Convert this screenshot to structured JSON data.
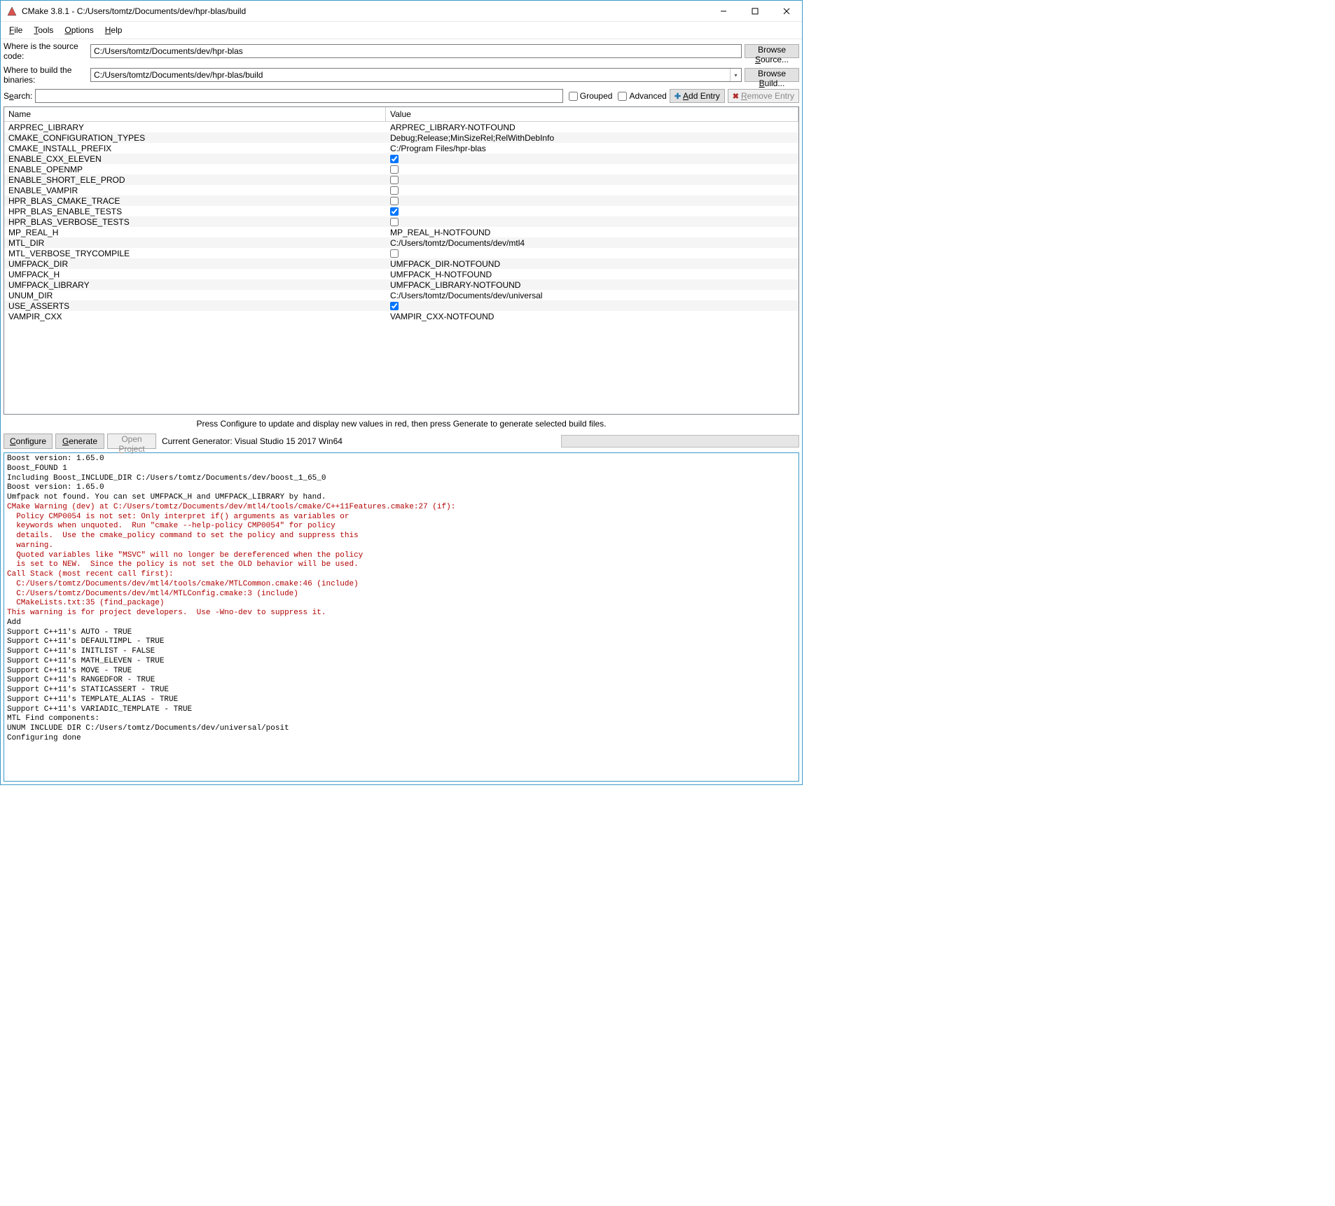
{
  "title": "CMake 3.8.1 - C:/Users/tomtz/Documents/dev/hpr-blas/build",
  "menu": {
    "file": "File",
    "tools": "Tools",
    "options": "Options",
    "help": "Help"
  },
  "paths": {
    "source_label": "Where is the source code:",
    "source_value": "C:/Users/tomtz/Documents/dev/hpr-blas",
    "browse_source": "Browse Source...",
    "build_label": "Where to build the binaries:",
    "build_value": "C:/Users/tomtz/Documents/dev/hpr-blas/build",
    "browse_build": "Browse Build..."
  },
  "search": {
    "label": "Search:",
    "value": "",
    "grouped_label": "Grouped",
    "grouped": false,
    "advanced_label": "Advanced",
    "advanced": false,
    "add_entry": "Add Entry",
    "remove_entry": "Remove Entry"
  },
  "table": {
    "header_name": "Name",
    "header_value": "Value",
    "rows": [
      {
        "name": "ARPREC_LIBRARY",
        "type": "text",
        "value": "ARPREC_LIBRARY-NOTFOUND"
      },
      {
        "name": "CMAKE_CONFIGURATION_TYPES",
        "type": "text",
        "value": "Debug;Release;MinSizeRel;RelWithDebInfo"
      },
      {
        "name": "CMAKE_INSTALL_PREFIX",
        "type": "text",
        "value": "C:/Program Files/hpr-blas"
      },
      {
        "name": "ENABLE_CXX_ELEVEN",
        "type": "bool",
        "checked": true
      },
      {
        "name": "ENABLE_OPENMP",
        "type": "bool",
        "checked": false
      },
      {
        "name": "ENABLE_SHORT_ELE_PROD",
        "type": "bool",
        "checked": false
      },
      {
        "name": "ENABLE_VAMPIR",
        "type": "bool",
        "checked": false
      },
      {
        "name": "HPR_BLAS_CMAKE_TRACE",
        "type": "bool",
        "checked": false
      },
      {
        "name": "HPR_BLAS_ENABLE_TESTS",
        "type": "bool",
        "checked": true
      },
      {
        "name": "HPR_BLAS_VERBOSE_TESTS",
        "type": "bool",
        "checked": false
      },
      {
        "name": "MP_REAL_H",
        "type": "text",
        "value": "MP_REAL_H-NOTFOUND"
      },
      {
        "name": "MTL_DIR",
        "type": "text",
        "value": "C:/Users/tomtz/Documents/dev/mtl4"
      },
      {
        "name": "MTL_VERBOSE_TRYCOMPILE",
        "type": "bool",
        "checked": false
      },
      {
        "name": "UMFPACK_DIR",
        "type": "text",
        "value": "UMFPACK_DIR-NOTFOUND"
      },
      {
        "name": "UMFPACK_H",
        "type": "text",
        "value": "UMFPACK_H-NOTFOUND"
      },
      {
        "name": "UMFPACK_LIBRARY",
        "type": "text",
        "value": "UMFPACK_LIBRARY-NOTFOUND"
      },
      {
        "name": "UNUM_DIR",
        "type": "text",
        "value": "C:/Users/tomtz/Documents/dev/universal"
      },
      {
        "name": "USE_ASSERTS",
        "type": "bool",
        "checked": true
      },
      {
        "name": "VAMPIR_CXX",
        "type": "text",
        "value": "VAMPIR_CXX-NOTFOUND"
      }
    ]
  },
  "hint": "Press Configure to update and display new values in red, then press Generate to generate selected build files.",
  "actions": {
    "configure": "Configure",
    "generate": "Generate",
    "open_project": "Open Project",
    "generator_label": "Current Generator: Visual Studio 15 2017 Win64"
  },
  "output_lines": [
    {
      "c": "k",
      "t": "Boost version: 1.65.0"
    },
    {
      "c": "k",
      "t": "Boost_FOUND 1"
    },
    {
      "c": "k",
      "t": "Including Boost_INCLUDE_DIR C:/Users/tomtz/Documents/dev/boost_1_65_0"
    },
    {
      "c": "k",
      "t": "Boost version: 1.65.0"
    },
    {
      "c": "k",
      "t": "Umfpack not found. You can set UMFPACK_H and UMFPACK_LIBRARY by hand."
    },
    {
      "c": "r",
      "t": "CMake Warning (dev) at C:/Users/tomtz/Documents/dev/mtl4/tools/cmake/C++11Features.cmake:27 (if):"
    },
    {
      "c": "r",
      "t": "  Policy CMP0054 is not set: Only interpret if() arguments as variables or"
    },
    {
      "c": "r",
      "t": "  keywords when unquoted.  Run \"cmake --help-policy CMP0054\" for policy"
    },
    {
      "c": "r",
      "t": "  details.  Use the cmake_policy command to set the policy and suppress this"
    },
    {
      "c": "r",
      "t": "  warning."
    },
    {
      "c": "r",
      "t": ""
    },
    {
      "c": "r",
      "t": "  Quoted variables like \"MSVC\" will no longer be dereferenced when the policy"
    },
    {
      "c": "r",
      "t": "  is set to NEW.  Since the policy is not set the OLD behavior will be used."
    },
    {
      "c": "r",
      "t": "Call Stack (most recent call first):"
    },
    {
      "c": "r",
      "t": "  C:/Users/tomtz/Documents/dev/mtl4/tools/cmake/MTLCommon.cmake:46 (include)"
    },
    {
      "c": "r",
      "t": "  C:/Users/tomtz/Documents/dev/mtl4/MTLConfig.cmake:3 (include)"
    },
    {
      "c": "r",
      "t": "  CMakeLists.txt:35 (find_package)"
    },
    {
      "c": "r",
      "t": "This warning is for project developers.  Use -Wno-dev to suppress it."
    },
    {
      "c": "k",
      "t": ""
    },
    {
      "c": "k",
      "t": "Add"
    },
    {
      "c": "k",
      "t": "Support C++11's AUTO - TRUE"
    },
    {
      "c": "k",
      "t": "Support C++11's DEFAULTIMPL - TRUE"
    },
    {
      "c": "k",
      "t": "Support C++11's INITLIST - FALSE"
    },
    {
      "c": "k",
      "t": "Support C++11's MATH_ELEVEN - TRUE"
    },
    {
      "c": "k",
      "t": "Support C++11's MOVE - TRUE"
    },
    {
      "c": "k",
      "t": "Support C++11's RANGEDFOR - TRUE"
    },
    {
      "c": "k",
      "t": "Support C++11's STATICASSERT - TRUE"
    },
    {
      "c": "k",
      "t": "Support C++11's TEMPLATE_ALIAS - TRUE"
    },
    {
      "c": "k",
      "t": "Support C++11's VARIADIC_TEMPLATE - TRUE"
    },
    {
      "c": "k",
      "t": "MTL Find components:"
    },
    {
      "c": "k",
      "t": "UNUM INCLUDE DIR C:/Users/tomtz/Documents/dev/universal/posit"
    },
    {
      "c": "k",
      "t": "Configuring done"
    }
  ]
}
